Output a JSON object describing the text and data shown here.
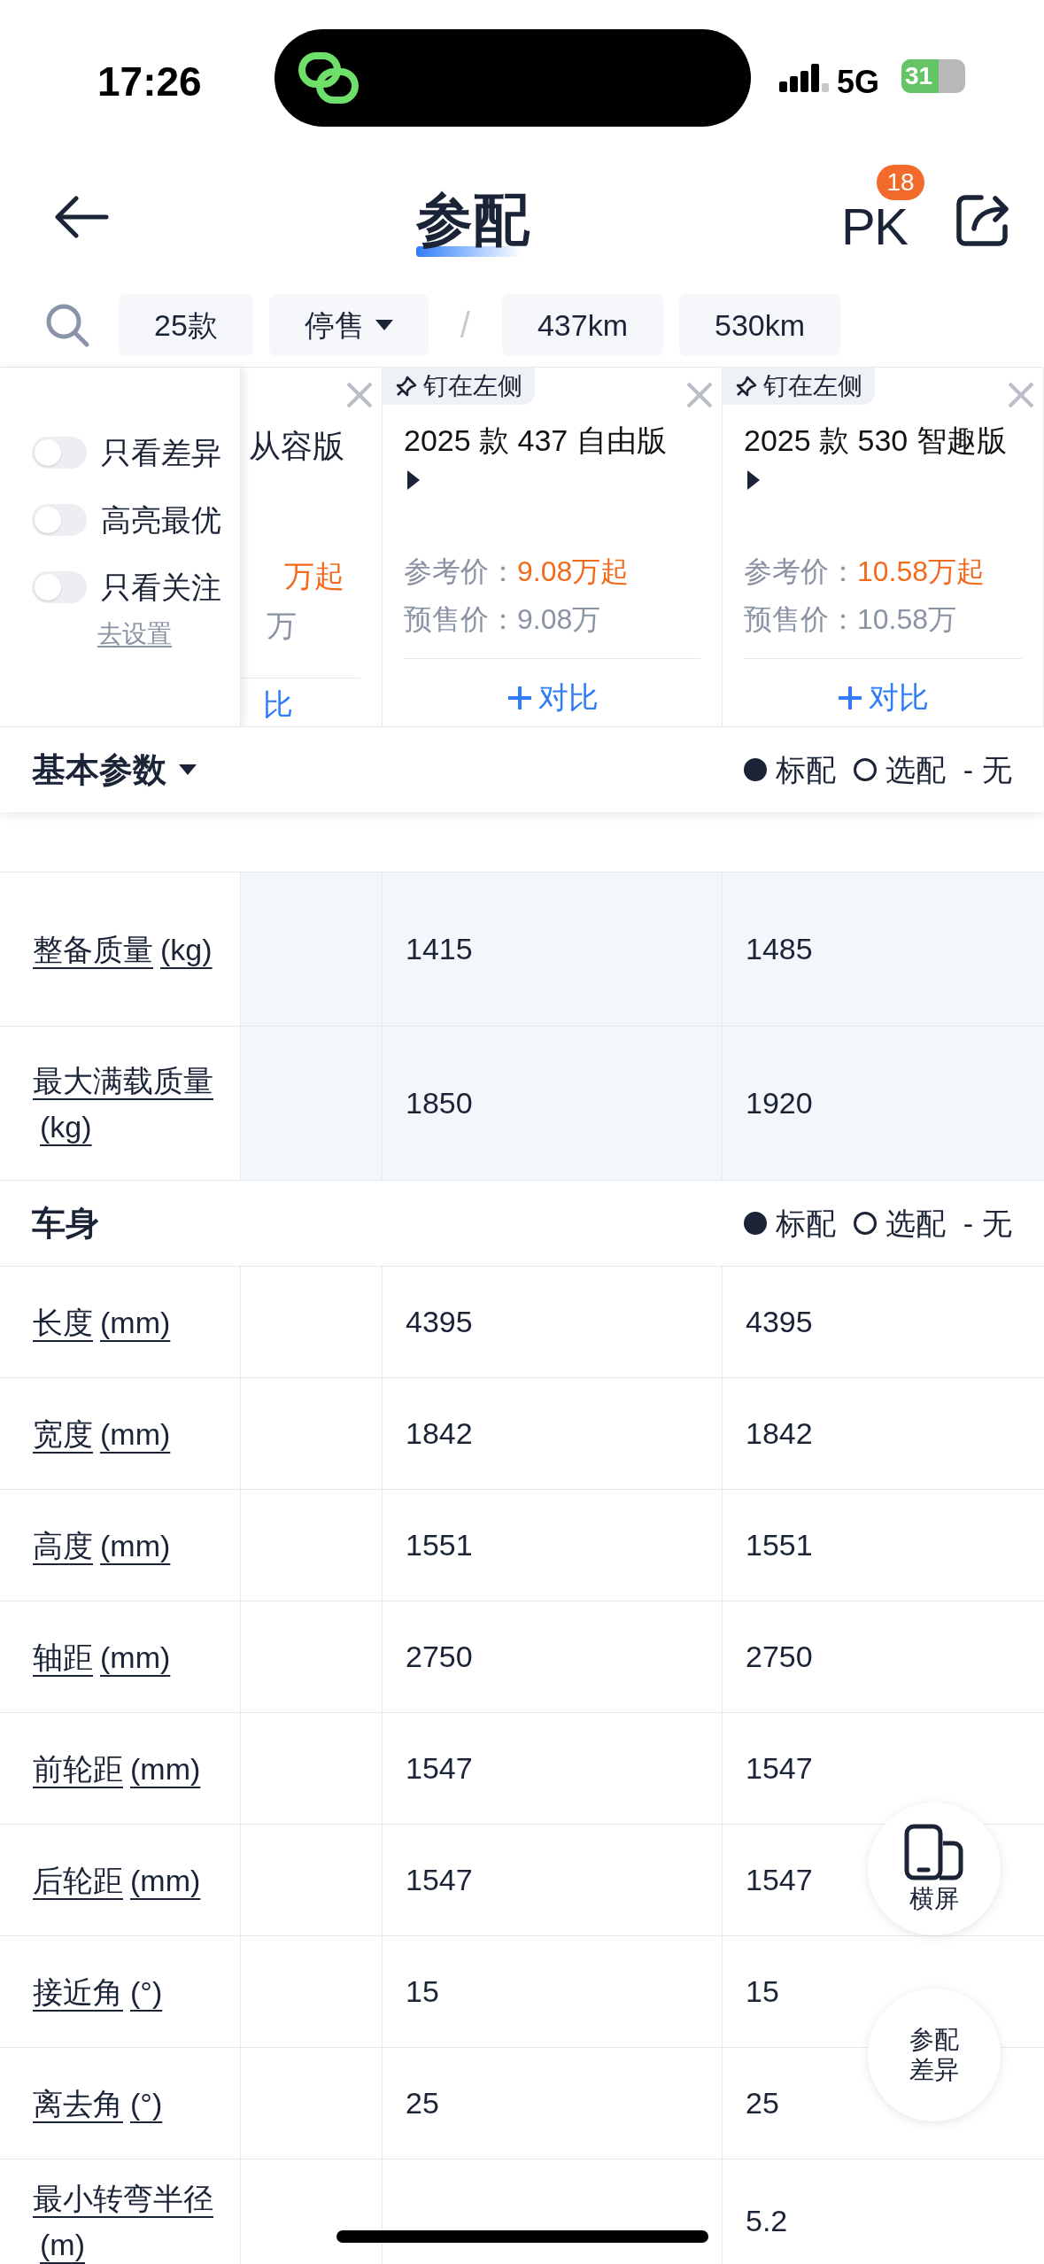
{
  "status_bar": {
    "time": "17:26",
    "network": "5G",
    "battery": "31"
  },
  "header": {
    "title": "参配",
    "pk_label": "PK",
    "pk_badge": "18"
  },
  "filters": [
    {
      "kind": "chip",
      "label": "25款"
    },
    {
      "kind": "dropdown",
      "label": "停售"
    },
    {
      "kind": "divider",
      "label": "/"
    },
    {
      "kind": "chip",
      "label": "437km"
    },
    {
      "kind": "chip",
      "label": "530km"
    }
  ],
  "toggles": [
    {
      "label": "只看差异",
      "on": false
    },
    {
      "label": "高亮最优",
      "on": false
    },
    {
      "label": "只看关注",
      "on": false
    }
  ],
  "settings_link": "去设置",
  "cars": [
    {
      "kind": "partial",
      "name": "从容版",
      "price": "万起",
      "presale": "万",
      "compare": "比"
    },
    {
      "kind": "full",
      "pin_label": "钉在左侧",
      "name": "2025 款 437 自由版",
      "price_label": "参考价：",
      "price": "9.08万起",
      "presale_label": "预售价：",
      "presale": "9.08万",
      "compare": "对比"
    },
    {
      "kind": "full",
      "pin_label": "钉在左侧",
      "name": "2025 款 530 智趣版",
      "price_label": "参考价：",
      "price": "10.58万起",
      "presale_label": "预售价：",
      "presale": "10.58万",
      "compare": "对比"
    }
  ],
  "sections": [
    {
      "kind": "dropdown",
      "title": "基本参数",
      "legend": [
        {
          "kind": "filled",
          "label": "标配"
        },
        {
          "kind": "hollow",
          "label": "选配"
        },
        {
          "kind": "dash",
          "mark": "-",
          "label": "无"
        }
      ],
      "rows": [
        {
          "kind": "hidden"
        },
        {
          "kind": "row",
          "label": "整备质量",
          "unit": "(kg)",
          "column_2": "1415",
          "column_3": "1485",
          "shaded": true
        },
        {
          "kind": "row",
          "label": "最大满载质量",
          "unit": "(kg)",
          "column_2": "1850",
          "column_3": "1920",
          "shaded": true
        }
      ]
    },
    {
      "kind": "plain",
      "title": "车身",
      "legend": [
        {
          "kind": "filled",
          "label": "标配"
        },
        {
          "kind": "hollow",
          "label": "选配"
        },
        {
          "kind": "dash",
          "mark": "-",
          "label": "无"
        }
      ],
      "rows": [
        {
          "kind": "row",
          "label": "长度",
          "unit": "(mm)",
          "column_2": "4395",
          "column_3": "4395",
          "shaded": false
        },
        {
          "kind": "row",
          "label": "宽度",
          "unit": "(mm)",
          "column_2": "1842",
          "column_3": "1842",
          "shaded": false
        },
        {
          "kind": "row",
          "label": "高度",
          "unit": "(mm)",
          "column_2": "1551",
          "column_3": "1551",
          "shaded": false
        },
        {
          "kind": "row",
          "label": "轴距",
          "unit": "(mm)",
          "column_2": "2750",
          "column_3": "2750",
          "shaded": false
        },
        {
          "kind": "row",
          "label": "前轮距",
          "unit": "(mm)",
          "column_2": "1547",
          "column_3": "1547",
          "shaded": false
        },
        {
          "kind": "row",
          "label": "后轮距",
          "unit": "(mm)",
          "column_2": "1547",
          "column_3": "1547",
          "shaded": false
        },
        {
          "kind": "row",
          "label": "接近角",
          "unit": "(°)",
          "column_2": "15",
          "column_3": "15",
          "shaded": false
        },
        {
          "kind": "row",
          "label": "离去角",
          "unit": "(°)",
          "column_2": "25",
          "column_3": "25",
          "shaded": false
        },
        {
          "kind": "last",
          "label": "最小转弯半径",
          "unit": "(m)",
          "column_3": "5.2",
          "shaded": false
        }
      ]
    }
  ],
  "float_buttons": [
    {
      "kind": "rotate",
      "label": "横屏"
    },
    {
      "kind": "text",
      "label": "参配差异"
    }
  ]
}
